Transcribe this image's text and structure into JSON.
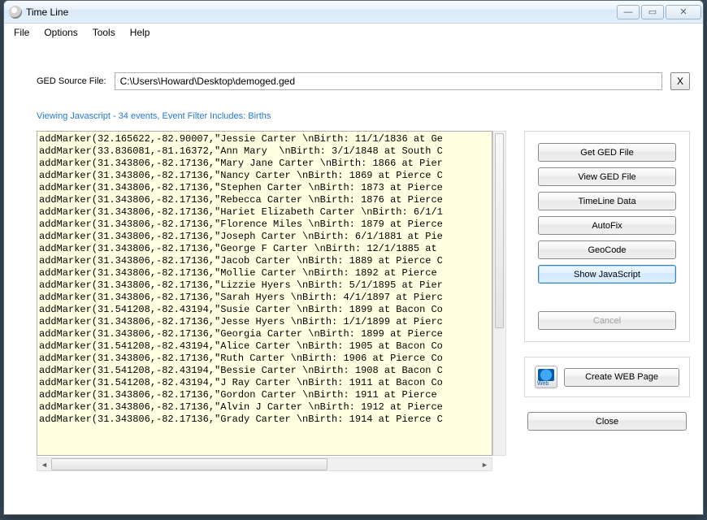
{
  "window": {
    "title": "Time Line"
  },
  "menu": {
    "file": "File",
    "options": "Options",
    "tools": "Tools",
    "help": "Help"
  },
  "ged": {
    "label": "GED Source File:",
    "path": "C:\\Users\\Howard\\Desktop\\demoged.ged",
    "x": "X"
  },
  "status": "Viewing Javascript - 34 events, Event Filter Includes:  Births",
  "code_lines": [
    "addMarker(32.165622,-82.90007,\"Jessie Carter \\nBirth: 11/1/1836 at Ge",
    "addMarker(33.836081,-81.16372,\"Ann Mary  \\nBirth: 3/1/1848 at South C",
    "addMarker(31.343806,-82.17136,\"Mary Jane Carter \\nBirth: 1866 at Pier",
    "addMarker(31.343806,-82.17136,\"Nancy Carter \\nBirth: 1869 at Pierce C",
    "addMarker(31.343806,-82.17136,\"Stephen Carter \\nBirth: 1873 at Pierce",
    "addMarker(31.343806,-82.17136,\"Rebecca Carter \\nBirth: 1876 at Pierce",
    "addMarker(31.343806,-82.17136,\"Hariet Elizabeth Carter \\nBirth: 6/1/1",
    "addMarker(31.343806,-82.17136,\"Florence Miles \\nBirth: 1879 at Pierce",
    "addMarker(31.343806,-82.17136,\"Joseph Carter \\nBirth: 6/1/1881 at Pie",
    "addMarker(31.343806,-82.17136,\"George F Carter \\nBirth: 12/1/1885 at ",
    "addMarker(31.343806,-82.17136,\"Jacob Carter \\nBirth: 1889 at Pierce C",
    "addMarker(31.343806,-82.17136,\"Mollie Carter \\nBirth: 1892 at Pierce ",
    "addMarker(31.343806,-82.17136,\"Lizzie Hyers \\nBirth: 5/1/1895 at Pier",
    "addMarker(31.343806,-82.17136,\"Sarah Hyers \\nBirth: 4/1/1897 at Pierc",
    "addMarker(31.541208,-82.43194,\"Susie Carter \\nBirth: 1899 at Bacon Co",
    "addMarker(31.343806,-82.17136,\"Jesse Hyers \\nBirth: 1/1/1899 at Pierc",
    "addMarker(31.343806,-82.17136,\"Georgia Carter \\nBirth: 1899 at Pierce",
    "addMarker(31.541208,-82.43194,\"Alice Carter \\nBirth: 1905 at Bacon Co",
    "addMarker(31.343806,-82.17136,\"Ruth Carter \\nBirth: 1906 at Pierce Co",
    "addMarker(31.541208,-82.43194,\"Bessie Carter \\nBirth: 1908 at Bacon C",
    "addMarker(31.541208,-82.43194,\"J Ray Carter \\nBirth: 1911 at Bacon Co",
    "addMarker(31.343806,-82.17136,\"Gordon Carter \\nBirth: 1911 at Pierce ",
    "addMarker(31.343806,-82.17136,\"Alvin J Carter \\nBirth: 1912 at Pierce",
    "addMarker(31.343806,-82.17136,\"Grady Carter \\nBirth: 1914 at Pierce C"
  ],
  "buttons": {
    "get_ged": "Get GED File",
    "view_ged": "View GED File",
    "timeline_data": "TimeLine Data",
    "autofix": "AutoFix",
    "geocode": "GeoCode",
    "show_js": "Show JavaScript",
    "cancel": "Cancel",
    "create_web": "Create WEB Page",
    "close": "Close"
  }
}
